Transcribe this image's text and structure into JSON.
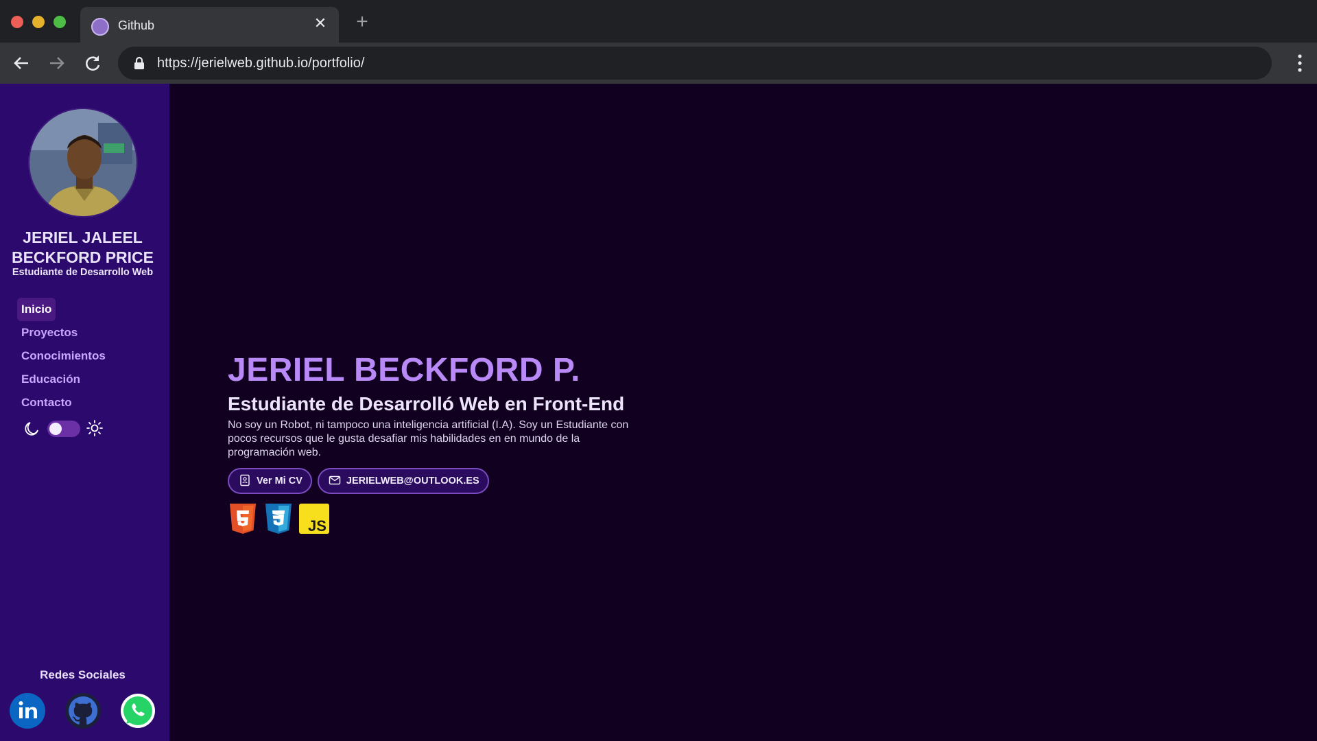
{
  "browser": {
    "tab_title": "Github",
    "tab_close": "✕",
    "new_tab": "+",
    "url": "https://jerielweb.github.io/portfolio/"
  },
  "sidebar": {
    "name": "JERIEL JALEEL BECKFORD PRICE",
    "role": "Estudiante de Desarrollo Web",
    "nav": [
      {
        "label": "Inicio",
        "active": true
      },
      {
        "label": "Proyectos",
        "active": false
      },
      {
        "label": "Conocimientos",
        "active": false
      },
      {
        "label": "Educación",
        "active": false
      },
      {
        "label": "Contacto",
        "active": false
      }
    ],
    "theme_toggle": {
      "state": "dark"
    },
    "social_title": "Redes Sociales",
    "social": [
      {
        "icon": "linkedin-icon",
        "color": "#0a66c2"
      },
      {
        "icon": "github-icon",
        "color": "#1b1f3a"
      },
      {
        "icon": "whatsapp-icon",
        "color": "#25d366"
      }
    ]
  },
  "hero": {
    "name": "JERIEL BECKFORD P.",
    "title": "Estudiante de Desarrolló Web en Front-End",
    "description": "No soy un Robot, ni tampoco una inteligencia artificial (I.A). Soy un Estudiante con pocos recursos que le gusta desafiar mis habilidades en en mundo de la programación web.",
    "cv_button": "Ver Mi CV",
    "email_button": "JERIELWEB@OUTLOOK.ES",
    "tech_icons": [
      "html5-icon",
      "css3-icon",
      "javascript-icon"
    ]
  },
  "colors": {
    "sidebar_bg": "#2c0a6d",
    "page_bg": "#120021",
    "accent": "#b98af7",
    "nav_link": "#c9a6ff"
  }
}
